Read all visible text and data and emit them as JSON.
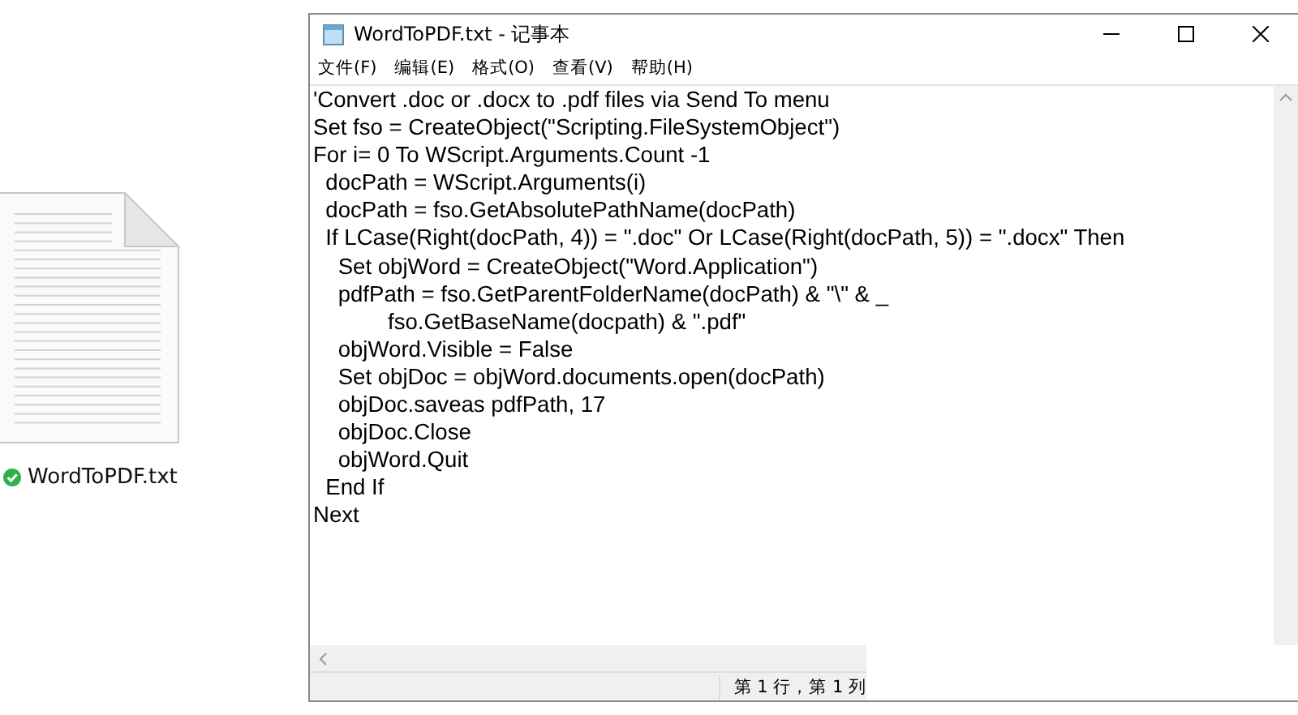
{
  "desktop_icon": {
    "label": "WordToPDF.txt",
    "synced": true
  },
  "window": {
    "title": "WordToPDF.txt - 记事本"
  },
  "menu": [
    "文件(F)",
    "编辑(E)",
    "格式(O)",
    "查看(V)",
    "帮助(H)"
  ],
  "editor": {
    "lines": [
      "'Convert .doc or .docx to .pdf files via Send To menu",
      "Set fso = CreateObject(\"Scripting.FileSystemObject\")",
      "For i= 0 To WScript.Arguments.Count -1",
      "  docPath = WScript.Arguments(i)",
      "  docPath = fso.GetAbsolutePathName(docPath)",
      "  If LCase(Right(docPath, 4)) = \".doc\" Or LCase(Right(docPath, 5)) = \".docx\" Then",
      "    Set objWord = CreateObject(\"Word.Application\")",
      "    pdfPath = fso.GetParentFolderName(docPath) & \"\\\" & _",
      "            fso.GetBaseName(docpath) & \".pdf\"",
      "    objWord.Visible = False",
      "    Set objDoc = objWord.documents.open(docPath)",
      "    objDoc.saveas pdfPath, 17",
      "    objDoc.Close",
      "    objWord.Quit",
      "  End If",
      "Next"
    ]
  },
  "status_bar": {
    "position": "第 1 行，第 1 列"
  }
}
